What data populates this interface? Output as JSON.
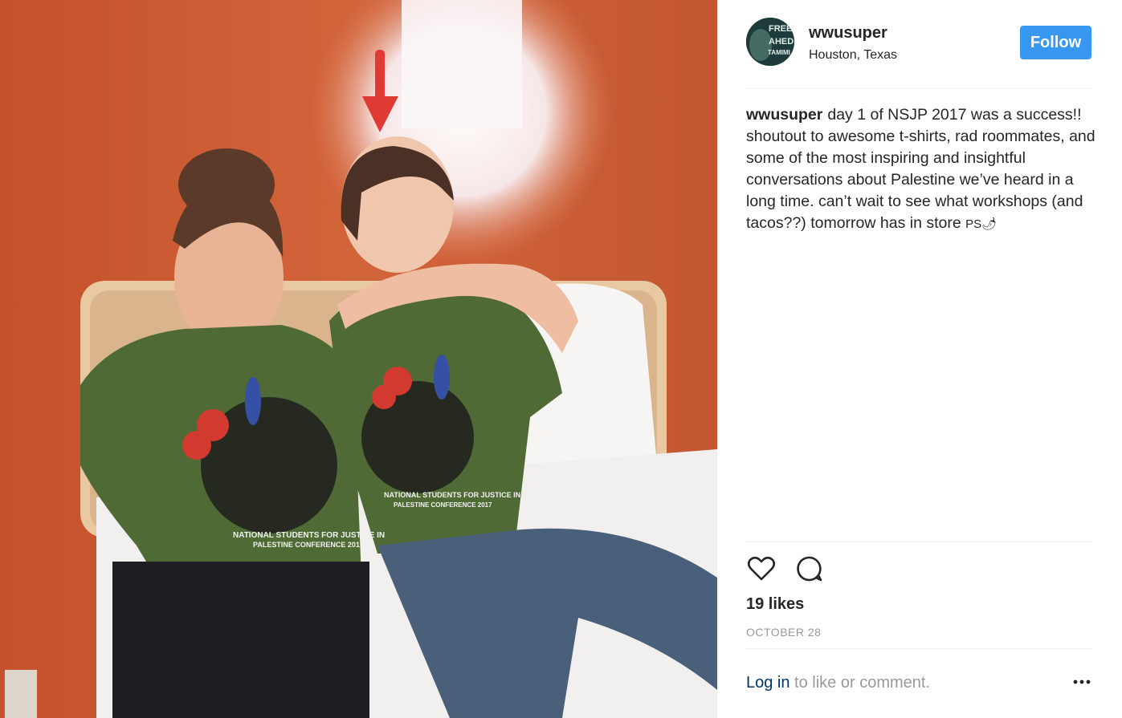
{
  "post": {
    "username": "wwusuper",
    "location": "Houston, Texas",
    "follow_label": "Follow",
    "avatar_text": [
      "FREE",
      "AHED",
      "TAMIMI"
    ],
    "caption_user": "wwusuper",
    "caption_text": "day 1 of NSJP 2017 was a success!! shoutout to awesome t-shirts, rad roommates, and some of the most inspiring and insightful conversations about Palestine we’ve heard in a long time. can’t wait to see what workshops (and tacos??) tomorrow has in store ",
    "caption_emoji": "PS🌶",
    "likes": "19 likes",
    "date": "OCTOBER 28",
    "login_link": "Log in",
    "login_rest": " to like or comment."
  },
  "photo": {
    "shirt_text_line1": "NATIONAL STUDENTS FOR JUSTICE IN",
    "shirt_text_line2": "PALESTINE CONFERENCE 2017"
  },
  "icons": {
    "like": "heart-icon",
    "comment": "comment-icon",
    "more": "more-options-icon",
    "annotation": "red-arrow"
  },
  "colors": {
    "follow_bg": "#3897f0",
    "link": "#003569",
    "wall": "#c8542c",
    "arrow": "#e03a34",
    "shirt": "#4f6a34"
  }
}
